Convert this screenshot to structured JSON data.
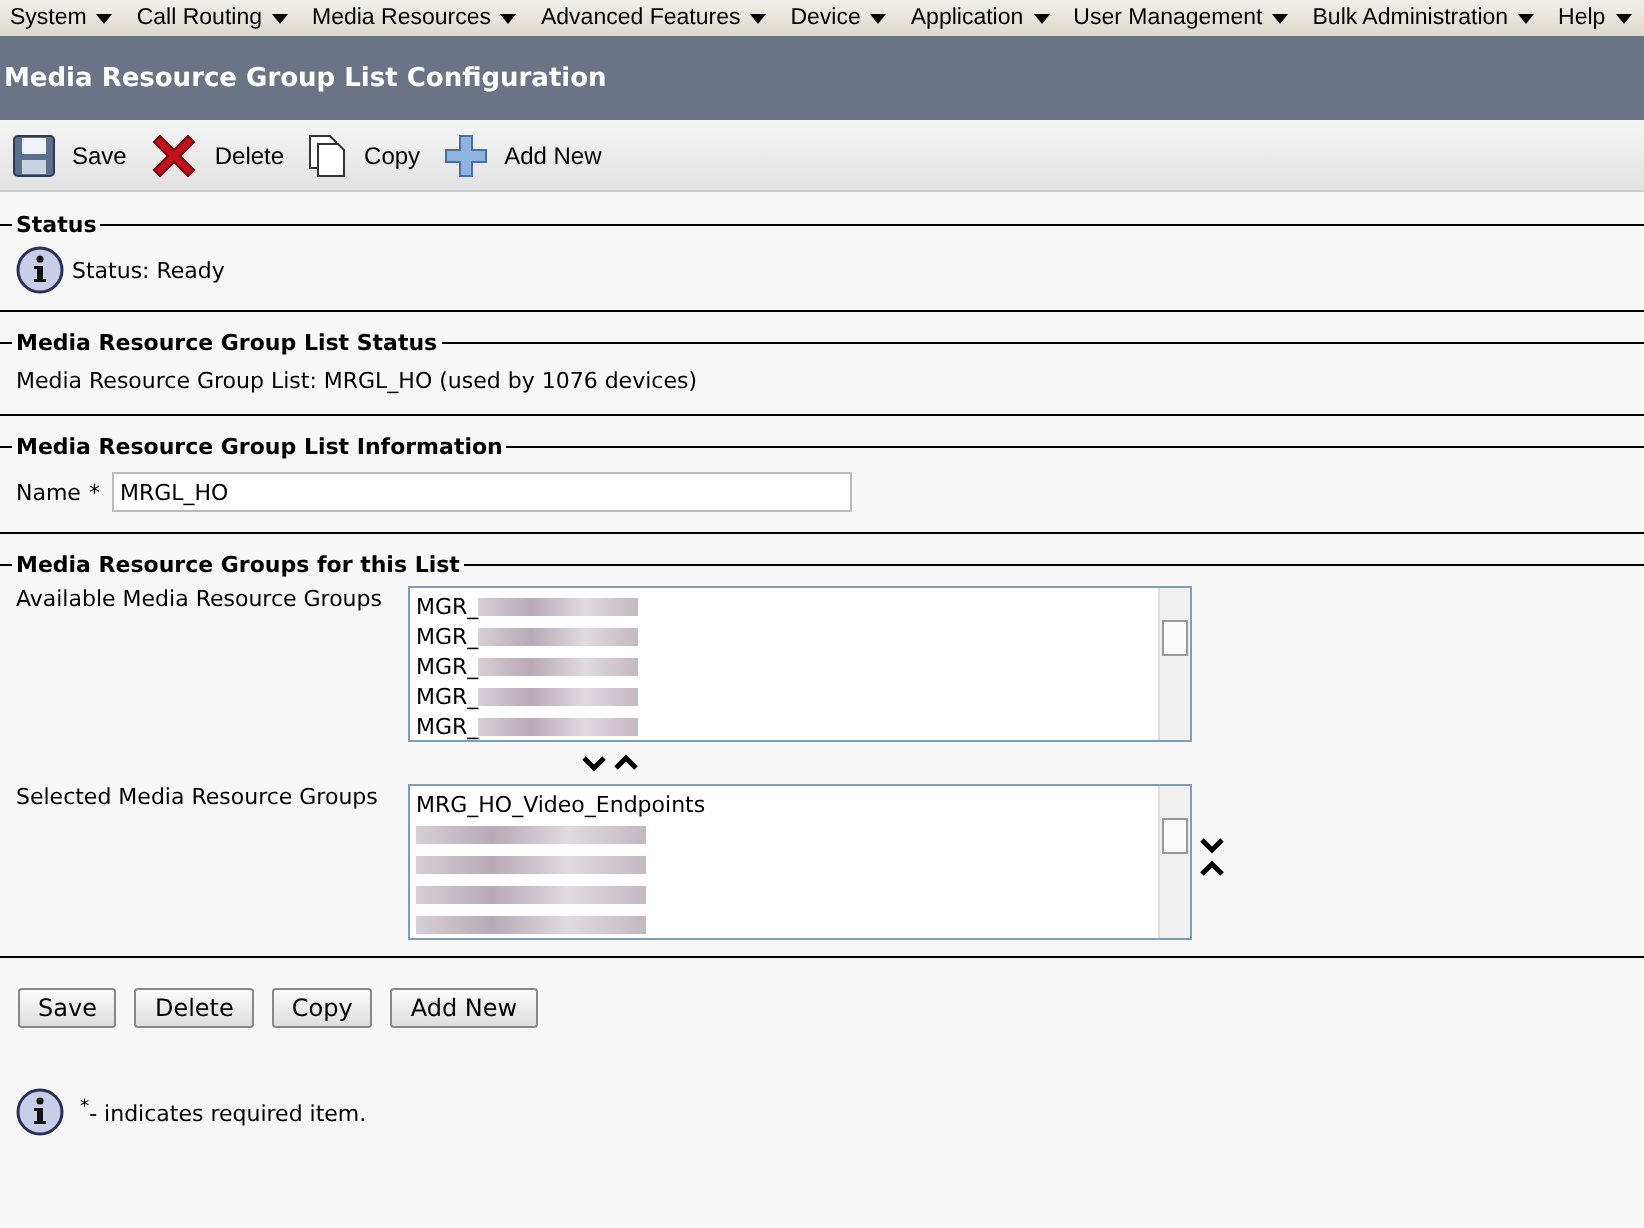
{
  "menu": [
    {
      "label": "System"
    },
    {
      "label": "Call Routing"
    },
    {
      "label": "Media Resources"
    },
    {
      "label": "Advanced Features"
    },
    {
      "label": "Device"
    },
    {
      "label": "Application"
    },
    {
      "label": "User Management"
    },
    {
      "label": "Bulk Administration"
    },
    {
      "label": "Help"
    }
  ],
  "window": {
    "title": "Media Resource Group List Configuration"
  },
  "toolbar": [
    {
      "label": "Save"
    },
    {
      "label": "Delete"
    },
    {
      "label": "Copy"
    },
    {
      "label": "Add New"
    }
  ],
  "status": {
    "legend": "Status",
    "text": "Status: Ready"
  },
  "list_status": {
    "legend": "Media Resource Group List Status",
    "text": "Media Resource Group List: MRGL_HO (used by 1076 devices)"
  },
  "info": {
    "legend": "Media Resource Group List Information",
    "label": "Name",
    "required_mark": "*",
    "value": "MRGL_HO"
  },
  "groups": {
    "legend": "Media Resource Groups for this List",
    "available": {
      "label": "Available Media Resource Groups",
      "items": [
        {
          "text": "MGR_",
          "redacted": true
        },
        {
          "text": "MGR_",
          "redacted": true
        },
        {
          "text": "MGR_",
          "redacted": true
        },
        {
          "text": "MGR_",
          "redacted": true
        },
        {
          "text": "MGR_",
          "redacted": true
        }
      ]
    },
    "selected": {
      "label": "Selected Media Resource Groups",
      "items": [
        {
          "text": "MRG_HO_Video_Endpoints",
          "redacted": false
        },
        {
          "redacted": true
        },
        {
          "redacted": true
        },
        {
          "redacted": true
        },
        {
          "redacted": true
        }
      ]
    }
  },
  "buttons": [
    {
      "label": "Save"
    },
    {
      "label": "Delete"
    },
    {
      "label": "Copy"
    },
    {
      "label": "Add New"
    }
  ],
  "note": {
    "mark": "*",
    "text": "- indicates required item."
  }
}
